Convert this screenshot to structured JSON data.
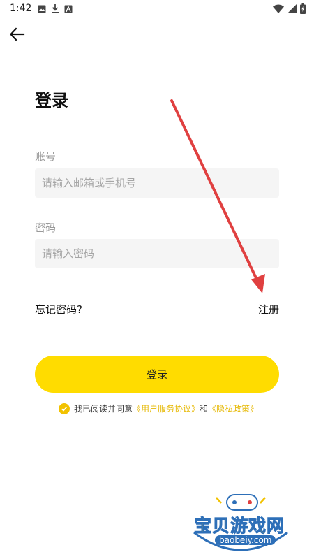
{
  "status_bar": {
    "time": "1:42",
    "left_icons": [
      "image-icon",
      "download-icon",
      "a-icon"
    ],
    "right_icons": [
      "wifi-icon",
      "signal-icon",
      "battery-icon"
    ]
  },
  "header": {
    "back_icon": "arrow-left-icon"
  },
  "page": {
    "title": "登录"
  },
  "account": {
    "label": "账号",
    "placeholder": "请输入邮箱或手机号",
    "value": ""
  },
  "password": {
    "label": "密码",
    "placeholder": "请输入密码",
    "value": ""
  },
  "links": {
    "forgot_password": "忘记密码?",
    "register": "注册"
  },
  "login_button": {
    "label": "登录"
  },
  "agreement": {
    "checked": true,
    "prefix": "我已阅读并同意",
    "user_agreement": "《用户服务协议》",
    "conjunction": "和",
    "privacy_policy": "《隐私政策》"
  },
  "watermark": {
    "title": "宝贝游戏网",
    "domain": "baobeiy.com"
  },
  "colors": {
    "accent": "#ffdc00",
    "check": "#f2c200",
    "link": "#e6b800",
    "input_bg": "#f5f5f5",
    "annotation_arrow": "#e04040"
  }
}
